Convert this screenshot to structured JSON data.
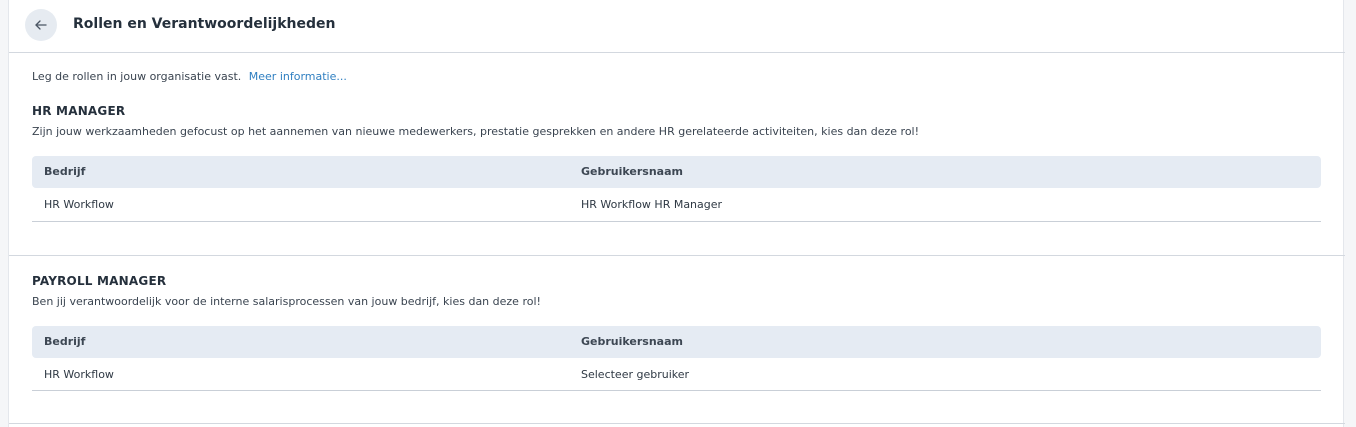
{
  "header": {
    "title": "Rollen en Verantwoordelijkheden",
    "back_icon": "arrow-left-icon"
  },
  "intro": {
    "text": "Leg de rollen in jouw organisatie vast.",
    "link": "Meer informatie..."
  },
  "roles": [
    {
      "title": "HR MANAGER",
      "description": "Zijn jouw werkzaamheden gefocust op het aannemen van nieuwe medewerkers, prestatie gesprekken en andere HR gerelateerde activiteiten, kies dan deze rol!",
      "columns": [
        "Bedrijf",
        "Gebruikersnaam"
      ],
      "rows": [
        [
          "HR Workflow",
          "HR Workflow HR Manager"
        ]
      ]
    },
    {
      "title": "PAYROLL MANAGER",
      "description": "Ben jij verantwoordelijk voor de interne salarisprocessen van jouw bedrijf, kies dan deze rol!",
      "columns": [
        "Bedrijf",
        "Gebruikersnaam"
      ],
      "rows": [
        [
          "HR Workflow",
          "Selecteer gebruiker"
        ]
      ]
    }
  ],
  "colors": {
    "page_bg": "#f5f6f8",
    "panel_bg": "#ffffff",
    "table_header_bg": "#e5ebf3",
    "link": "#2f7fc1",
    "back_button_bg": "#e6ebf1"
  }
}
